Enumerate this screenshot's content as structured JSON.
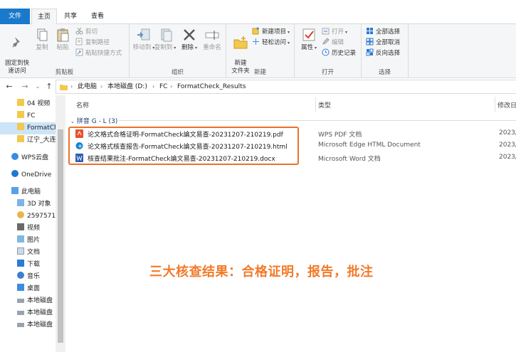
{
  "ribbon_tabs": {
    "file": "文件",
    "home": "主页",
    "share": "共享",
    "view": "查看"
  },
  "clipboard": {
    "pin_quick_access": "固定到快\n速访问",
    "copy": "复制",
    "paste": "粘贴",
    "cut": "剪切",
    "copy_path": "复制路径",
    "paste_shortcut": "粘贴快捷方式",
    "group_label": "剪贴板"
  },
  "organize": {
    "move_to": "移动到",
    "copy_to": "复制到",
    "delete": "删除",
    "rename": "重命名",
    "group_label": "组织"
  },
  "new": {
    "new_folder": "新建\n文件夹",
    "new_item": "新建项目",
    "easy_access": "轻松访问",
    "group_label": "新建"
  },
  "open": {
    "properties": "属性",
    "open": "打开",
    "edit": "编辑",
    "history": "历史记录",
    "group_label": "打开"
  },
  "select": {
    "select_all": "全部选择",
    "select_none": "全部取消",
    "invert": "反向选择",
    "group_label": "选择"
  },
  "nav_buttons": {
    "back": "←",
    "forward": "→",
    "dropdown": "⌄",
    "up": "↑"
  },
  "breadcrumb": [
    "此电脑",
    "本地磁盘 (D:)",
    "FC",
    "FormatCheck_Results"
  ],
  "nav_pane": {
    "items": [
      {
        "label": "04 视频",
        "icon": "folder-icon"
      },
      {
        "label": "FC",
        "icon": "folder-icon"
      },
      {
        "label": "FormatCh",
        "icon": "folder-icon",
        "selected": true
      },
      {
        "label": "辽宁_大连",
        "icon": "folder-icon"
      },
      {
        "label": "WPS云盘",
        "icon": "cloud-icon"
      },
      {
        "label": "OneDrive",
        "icon": "cloud-icon"
      },
      {
        "label": "此电脑",
        "icon": "computer-icon"
      },
      {
        "label": "3D 对象",
        "icon": "cube-icon"
      },
      {
        "label": "2597571",
        "icon": "user-icon"
      },
      {
        "label": "视频",
        "icon": "video-icon"
      },
      {
        "label": "图片",
        "icon": "picture-icon"
      },
      {
        "label": "文档",
        "icon": "document-icon"
      },
      {
        "label": "下载",
        "icon": "download-icon"
      },
      {
        "label": "音乐",
        "icon": "music-icon"
      },
      {
        "label": "桌面",
        "icon": "desktop-icon"
      },
      {
        "label": "本地磁盘",
        "icon": "drive-icon"
      },
      {
        "label": "本地磁盘",
        "icon": "drive-icon"
      },
      {
        "label": "本地磁盘",
        "icon": "drive-icon"
      }
    ]
  },
  "columns": {
    "name": "名称",
    "type": "类型",
    "modified": "修改日"
  },
  "group_header": "拼音 G - L (3)",
  "files": [
    {
      "name": "论文格式合格证明-FormatCheck論文易查-20231207-210219.pdf",
      "type": "WPS PDF 文档",
      "date": "2023/",
      "icon": "pdf-icon",
      "color": "#e8502d"
    },
    {
      "name": "论文格式核查报告-FormatCheck論文易查-20231207-210219.html",
      "type": "Microsoft Edge HTML Document",
      "date": "2023/",
      "icon": "edge-icon",
      "color": "#1d7fcf"
    },
    {
      "name": "核查结果批注-FormatCheck論文易查-20231207-210219.docx",
      "type": "Microsoft Word 文档",
      "date": "2023/",
      "icon": "word-icon",
      "color": "#2b5fb4"
    }
  ],
  "caption": "三大核查结果：合格证明，报告，批注",
  "colors": {
    "accent": "#1979ca",
    "highlight": "#e8732b",
    "caption": "#f27a2a"
  }
}
